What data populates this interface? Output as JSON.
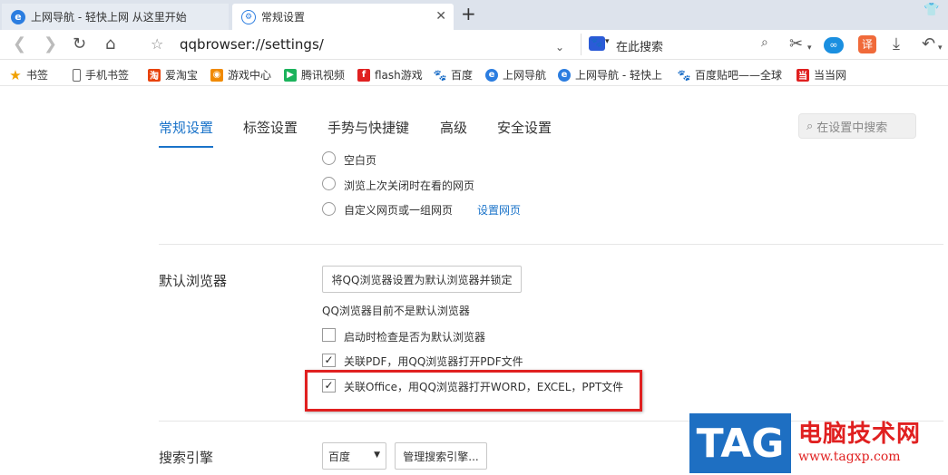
{
  "tabs": [
    {
      "label": "上网导航 - 轻快上网 从这里开始",
      "icon": "ie-e-icon"
    },
    {
      "label": "常规设置",
      "icon": "settings-gear-icon"
    }
  ],
  "toolbar": {
    "address": "qqbrowser://settings/",
    "search_engine_placeholder": "在此搜索",
    "translate_label": "译"
  },
  "bookmarks": [
    {
      "label": "书签",
      "icon": "star-icon",
      "color": "#f0a000"
    },
    {
      "label": "手机书签",
      "icon": "phone-icon",
      "color": "#666666"
    },
    {
      "label": "爱淘宝",
      "icon": "taobao-icon",
      "color": "#e8430c"
    },
    {
      "label": "游戏中心",
      "icon": "game-icon",
      "color": "#f08a00"
    },
    {
      "label": "腾讯视频",
      "icon": "video-icon",
      "color": "#1cb35c"
    },
    {
      "label": "flash游戏",
      "icon": "flash-icon",
      "color": "#e02020"
    },
    {
      "label": "百度",
      "icon": "baidu-paw-icon",
      "color": "#2b5bd7"
    },
    {
      "label": "上网导航",
      "icon": "ie-e-icon",
      "color": "#2b7de0"
    },
    {
      "label": "上网导航 - 轻快上",
      "icon": "ie-e-icon",
      "color": "#2b7de0"
    },
    {
      "label": "百度贴吧——全球",
      "icon": "baidu-paw-icon",
      "color": "#2b5bd7"
    },
    {
      "label": "当当网",
      "icon": "dangdang-icon",
      "color": "#e02020"
    }
  ],
  "settings_tabs": [
    "常规设置",
    "标签设置",
    "手势与快捷键",
    "高级",
    "安全设置"
  ],
  "settings_search_placeholder": "在设置中搜索",
  "startup_options": {
    "blank": "空白页",
    "last_session": "浏览上次关闭时在看的网页",
    "custom": "自定义网页或一组网页",
    "set_pages_link": "设置网页"
  },
  "default_browser": {
    "heading": "默认浏览器",
    "set_button": "将QQ浏览器设置为默认浏览器并锁定",
    "status": "QQ浏览器目前不是默认浏览器",
    "check_on_startup": {
      "label": "启动时检查是否为默认浏览器",
      "checked": false
    },
    "assoc_pdf": {
      "label": "关联PDF，用QQ浏览器打开PDF文件",
      "checked": true
    },
    "assoc_office": {
      "label": "关联Office，用QQ浏览器打开WORD，EXCEL，PPT文件",
      "checked": true
    }
  },
  "search_engine": {
    "heading": "搜索引擎",
    "selected": "百度",
    "manage_button": "管理搜索引擎..."
  },
  "watermark": {
    "tag": "TAG",
    "title": "电脑技术网",
    "url": "www.tagxp.com"
  },
  "colors": {
    "accent": "#1a73c9",
    "highlight_box": "#e02020"
  }
}
